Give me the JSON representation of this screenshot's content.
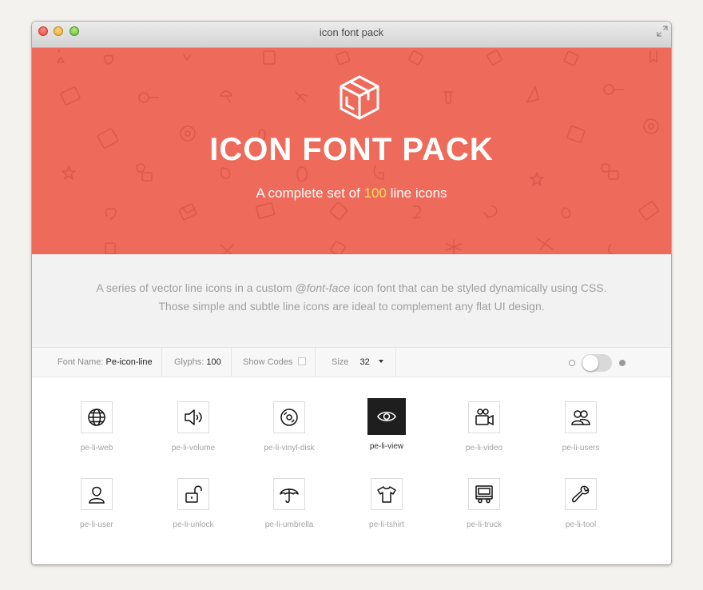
{
  "window": {
    "title": "icon font pack"
  },
  "hero": {
    "title": "ICON FONT PACK",
    "subtitle_before": "A complete set of ",
    "subtitle_accent": "100",
    "subtitle_after": " line icons",
    "background_color": "#ee6a5b",
    "accent_color": "#f5e35c",
    "logo_icon": "box-icon"
  },
  "description": {
    "line1_before": "A series of vector line icons in a custom ",
    "line1_emphasis": "@font-face",
    "line1_after": " icon font that can be styled dynamically using CSS.",
    "line2": "Those simple and subtle line icons are ideal to complement any flat UI design."
  },
  "toolbar": {
    "font_name_label": "Font Name:",
    "font_name_value": "Pe-icon-line",
    "glyphs_label": "Glyphs:",
    "glyphs_value": "100",
    "show_codes_label": "Show Codes",
    "show_codes_checked": false,
    "size_label": "Size",
    "size_value": "32",
    "theme_toggle_on": false
  },
  "icons": [
    {
      "label": "pe-li-web",
      "icon": "globe-icon"
    },
    {
      "label": "pe-li-volume",
      "icon": "volume-icon"
    },
    {
      "label": "pe-li-vinyl-disk",
      "icon": "vinyl-disk-icon"
    },
    {
      "label": "pe-li-view",
      "icon": "eye-icon",
      "selected": true
    },
    {
      "label": "pe-li-video",
      "icon": "video-camera-icon"
    },
    {
      "label": "pe-li-users",
      "icon": "users-icon"
    },
    {
      "label": "pe-li-user",
      "icon": "user-icon"
    },
    {
      "label": "pe-li-unlock",
      "icon": "unlock-icon"
    },
    {
      "label": "pe-li-umbrella",
      "icon": "umbrella-icon"
    },
    {
      "label": "pe-li-tshirt",
      "icon": "tshirt-icon"
    },
    {
      "label": "pe-li-truck",
      "icon": "truck-icon"
    },
    {
      "label": "pe-li-tool",
      "icon": "wrench-icon"
    }
  ]
}
